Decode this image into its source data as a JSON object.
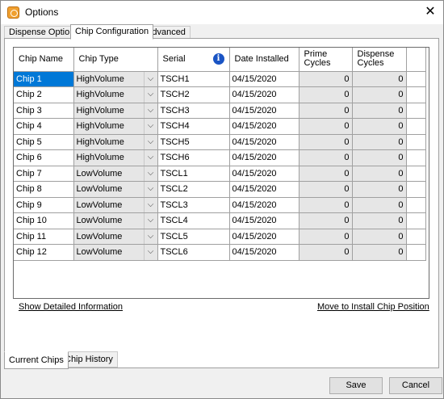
{
  "window": {
    "title": "Options",
    "close_symbol": "✕"
  },
  "tabs": [
    {
      "label": "Dispense Options",
      "active": false
    },
    {
      "label": "Chip Configuration",
      "active": true
    },
    {
      "label": "Advanced",
      "active": false
    }
  ],
  "grid": {
    "columns": [
      "Chip Name",
      "Chip Type",
      "Serial",
      "Date Installed",
      "Prime\nCycles",
      "Dispense\nCycles"
    ],
    "rows": [
      {
        "name": "Chip 1",
        "type": "HighVolume",
        "serial": "TSCH1",
        "date": "04/15/2020",
        "prime": "0",
        "dispense": "0",
        "selected": true
      },
      {
        "name": "Chip 2",
        "type": "HighVolume",
        "serial": "TSCH2",
        "date": "04/15/2020",
        "prime": "0",
        "dispense": "0"
      },
      {
        "name": "Chip 3",
        "type": "HighVolume",
        "serial": "TSCH3",
        "date": "04/15/2020",
        "prime": "0",
        "dispense": "0"
      },
      {
        "name": "Chip 4",
        "type": "HighVolume",
        "serial": "TSCH4",
        "date": "04/15/2020",
        "prime": "0",
        "dispense": "0"
      },
      {
        "name": "Chip 5",
        "type": "HighVolume",
        "serial": "TSCH5",
        "date": "04/15/2020",
        "prime": "0",
        "dispense": "0"
      },
      {
        "name": "Chip 6",
        "type": "HighVolume",
        "serial": "TSCH6",
        "date": "04/15/2020",
        "prime": "0",
        "dispense": "0"
      },
      {
        "name": "Chip 7",
        "type": "LowVolume",
        "serial": "TSCL1",
        "date": "04/15/2020",
        "prime": "0",
        "dispense": "0"
      },
      {
        "name": "Chip 8",
        "type": "LowVolume",
        "serial": "TSCL2",
        "date": "04/15/2020",
        "prime": "0",
        "dispense": "0"
      },
      {
        "name": "Chip 9",
        "type": "LowVolume",
        "serial": "TSCL3",
        "date": "04/15/2020",
        "prime": "0",
        "dispense": "0"
      },
      {
        "name": "Chip 10",
        "type": "LowVolume",
        "serial": "TSCL4",
        "date": "04/15/2020",
        "prime": "0",
        "dispense": "0"
      },
      {
        "name": "Chip 11",
        "type": "LowVolume",
        "serial": "TSCL5",
        "date": "04/15/2020",
        "prime": "0",
        "dispense": "0"
      },
      {
        "name": "Chip 12",
        "type": "LowVolume",
        "serial": "TSCL6",
        "date": "04/15/2020",
        "prime": "0",
        "dispense": "0"
      }
    ]
  },
  "links": {
    "show_details": "Show Detailed Information",
    "move_to_install": "Move to Install Chip Position"
  },
  "bottom_tabs": [
    {
      "label": "Current Chips",
      "active": true
    },
    {
      "label": "Chip History",
      "active": false
    }
  ],
  "buttons": {
    "save": "Save",
    "cancel": "Cancel"
  },
  "icons": {
    "info": "i",
    "dropdown": "⌵"
  },
  "colors": {
    "selection": "#0078d7",
    "info_icon": "#1a54c4"
  }
}
